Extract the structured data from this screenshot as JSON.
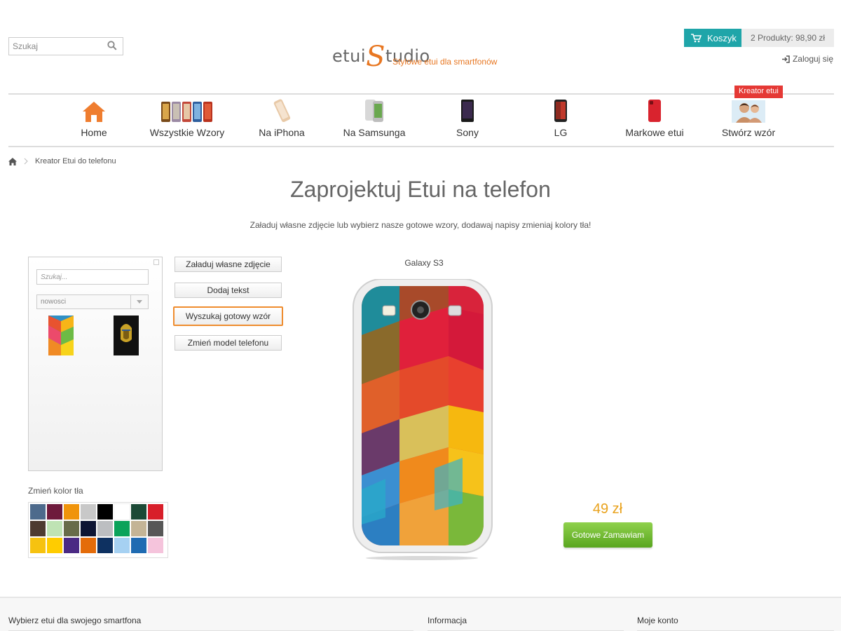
{
  "header": {
    "search_placeholder": "Szukaj",
    "logo_prefix": "etui",
    "logo_s": "S",
    "logo_suffix": "tudio",
    "logo_tagline": "Stylowe etui dla smartfonów",
    "cart_label": "Koszyk",
    "cart_summary": "2 Produkty: 98,90 zł",
    "login_label": "Zaloguj się"
  },
  "nav": {
    "items": [
      {
        "label": "Home",
        "icon": "home-icon"
      },
      {
        "label": "Wszystkie Wzory",
        "icon": "cases-icon"
      },
      {
        "label": "Na iPhona",
        "icon": "iphone-icon"
      },
      {
        "label": "Na Samsunga",
        "icon": "samsung-icon"
      },
      {
        "label": "Sony",
        "icon": "sony-icon"
      },
      {
        "label": "LG",
        "icon": "lg-icon"
      },
      {
        "label": "Markowe etui",
        "icon": "branded-case-icon"
      },
      {
        "label": "Stwórz wzór",
        "icon": "create-design-icon"
      }
    ],
    "badge": "Kreator etui"
  },
  "breadcrumb": {
    "current": "Kreator Etui do telefonu"
  },
  "main": {
    "title": "Zaprojektuj Etui na telefon",
    "subtitle": "Załaduj własne zdjęcie lub wybierz nasze gotowe wzory, dodawaj napisy zmieniaj kolory tła!"
  },
  "panel": {
    "search_placeholder": "Szukaj...",
    "sort_value": "nowosci"
  },
  "tools": {
    "upload": "Załaduj własne zdjęcie",
    "add_text": "Dodaj tekst",
    "find_design": "Wyszukaj gotowy wzór",
    "change_model": "Zmień model telefonu"
  },
  "colors": {
    "label": "Zmień kolor tła",
    "swatches": [
      "#4d6a8c",
      "#6e1a3c",
      "#f0940b",
      "#c8c8c8",
      "#000000",
      "#ffffff",
      "#1c4a36",
      "#d81f2a",
      "#4e3b31",
      "#bfe3b4",
      "#686c4a",
      "#0d1534",
      "#bcbec1",
      "#0aa35a",
      "#c4b496",
      "#575757",
      "#f6c210",
      "#ffcc00",
      "#4b2a84",
      "#e46c0a",
      "#0e3161",
      "#a6d1f2",
      "#1f6bb2",
      "#f5c4dc"
    ]
  },
  "product": {
    "model": "Galaxy S3",
    "price": "49 zł",
    "order_label": "Gotowe Zamawiam"
  },
  "footer": {
    "col1": "Wybierz etui dla swojego smartfona",
    "col2": "Informacja",
    "col3": "Moje konto"
  }
}
